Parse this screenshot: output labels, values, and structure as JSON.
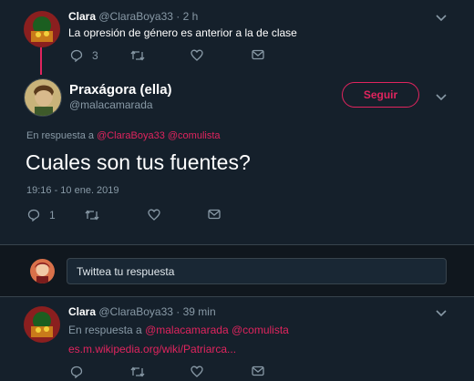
{
  "tweet_top": {
    "name": "Clara",
    "handle": "@ClaraBoya33",
    "time": "· 2 h",
    "text": "La opresión de género es anterior a la de clase",
    "reply_count": "3"
  },
  "main_tweet": {
    "name": "Praxágora (ella)",
    "handle": "@malacamarada",
    "follow_label": "Seguir",
    "in_reply_prefix": "En respuesta a",
    "mention_1": "@ClaraBoya33",
    "mention_2": "@comulista",
    "text": "Cuales son tus fuentes?",
    "timestamp": "19:16 - 10 ene. 2019",
    "reply_count": "1"
  },
  "reply_input": {
    "placeholder": "Twittea tu respuesta"
  },
  "tweet_bottom": {
    "name": "Clara",
    "handle": "@ClaraBoya33",
    "time": "· 39 min",
    "in_reply_prefix": "En respuesta a",
    "mention_1": "@malacamarada",
    "mention_2": "@comulista",
    "link": "es.m.wikipedia.org/wiki/Patriarca..."
  },
  "colors": {
    "background": "#15202b",
    "accent": "#e0245e",
    "muted": "#8899a6"
  }
}
